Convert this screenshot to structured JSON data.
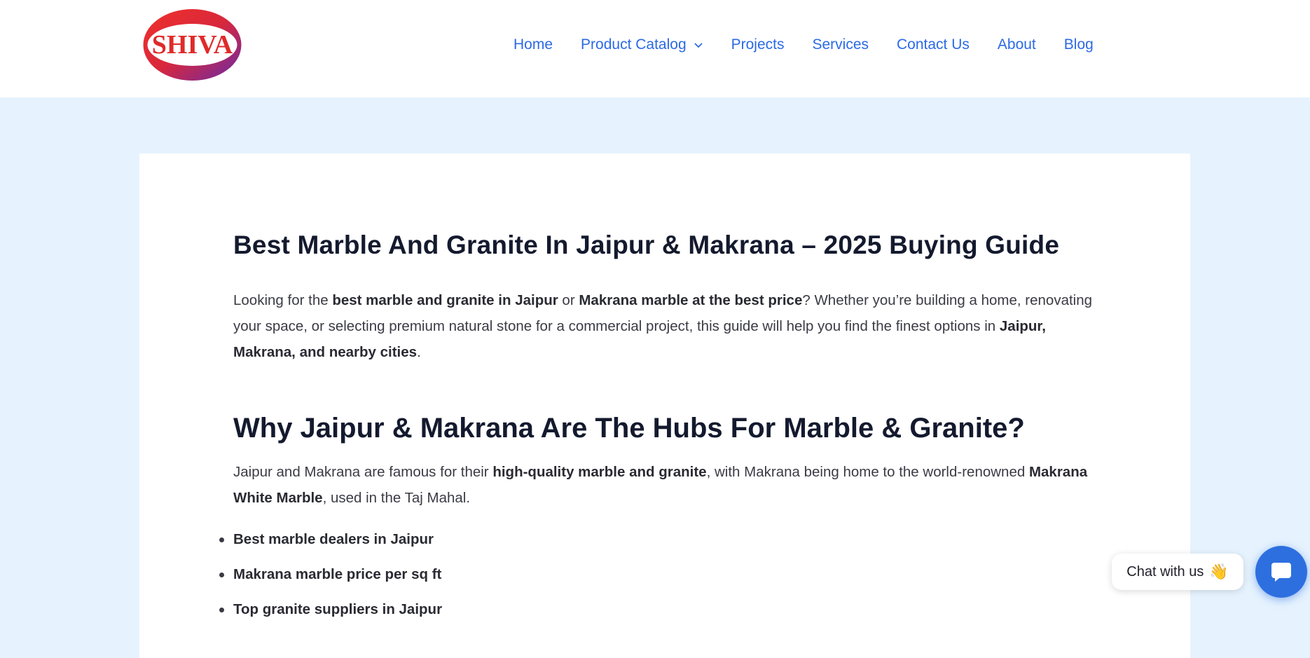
{
  "brand": {
    "logo_text": "SHIVA"
  },
  "nav": {
    "items": [
      {
        "label": "Home"
      },
      {
        "label": "Product Catalog"
      },
      {
        "label": "Projects"
      },
      {
        "label": "Services"
      },
      {
        "label": "Contact Us"
      },
      {
        "label": "About"
      },
      {
        "label": "Blog"
      }
    ]
  },
  "article": {
    "title": "Best Marble And Granite In Jaipur & Makrana – 2025 Buying Guide",
    "intro": {
      "t1": "Looking for the ",
      "b1": "best marble and granite in Jaipur",
      "t2": " or ",
      "b2": "Makrana marble at the best price",
      "t3": "? Whether you’re building a home, renovating your space, or selecting premium natural stone for a commercial project, this guide will help you find the finest options in ",
      "b3": "Jaipur, Makrana, and nearby cities",
      "t4": "."
    },
    "section_heading": "Why Jaipur & Makrana Are The Hubs For Marble & Granite?",
    "section_para": {
      "t1": "Jaipur and Makrana are famous for their ",
      "b1": "high-quality marble and granite",
      "t2": ", with Makrana being home to the world-renowned ",
      "b2": "Makrana White Marble",
      "t3": ", used in the Taj Mahal."
    },
    "list": [
      "Best marble dealers in Jaipur",
      "Makrana marble price per sq ft",
      "Top granite suppliers in Jaipur"
    ]
  },
  "chat": {
    "label": "Chat with us",
    "emoji": "👋"
  },
  "colors": {
    "nav_link": "#2b6ae6",
    "page_bg": "#e6f3fe",
    "chat_button": "#2e6fe0"
  }
}
